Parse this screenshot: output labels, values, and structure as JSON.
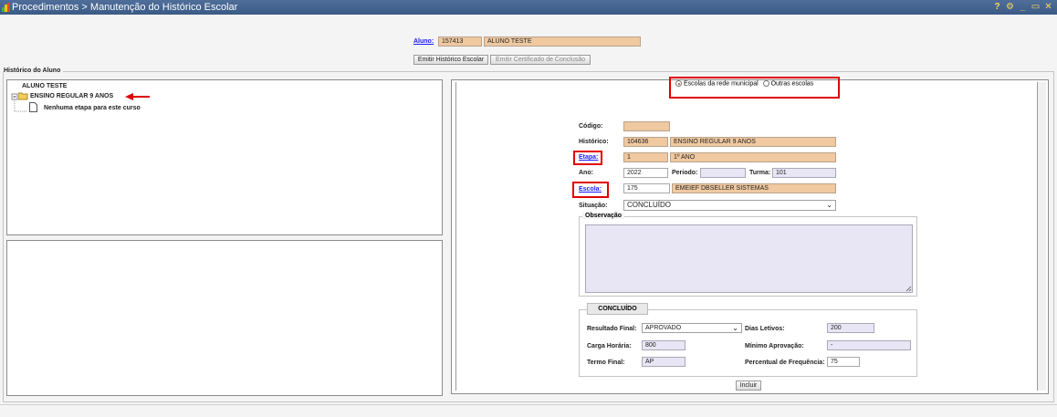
{
  "window": {
    "title": "Procedimentos > Manutenção do Histórico Escolar",
    "controls": [
      "?",
      "⚙",
      "_",
      "▭",
      "✕"
    ]
  },
  "aluno": {
    "label": "Aluno:",
    "code": "157413",
    "name": "ALUNO TESTE"
  },
  "buttons": {
    "emitir_historico": "Emitir Histórico Escolar",
    "emitir_certificado": "Emitir Certificado de Conclusão",
    "incluir": "Incluir"
  },
  "historico_section": {
    "title": "Histórico do Aluno",
    "tree_root": "ALUNO TESTE",
    "tree_course": "ENSINO REGULAR 9 ANOS",
    "tree_empty": "Nenhuma etapa para este curso"
  },
  "school_filter": {
    "option_municipal": "Escolas da rede municipal",
    "option_outras": "Outras escolas",
    "selected": "municipal"
  },
  "form": {
    "codigo_label": "Código:",
    "codigo_value": "",
    "historico_label": "Histórico:",
    "historico_code": "104636",
    "historico_name": "ENSINO REGULAR 9 ANOS",
    "etapa_label": "Etapa:",
    "etapa_code": "1",
    "etapa_name": "1º ANO",
    "ano_label": "Ano:",
    "ano_value": "2022",
    "periodo_label": "Periodo:",
    "periodo_value": "",
    "turma_label": "Turma:",
    "turma_value": "101",
    "escola_label": "Escola:",
    "escola_code": "175",
    "escola_name": "EMEIEF DBSELLER SISTEMAS",
    "situacao_label": "Situação:",
    "situacao_value": "CONCLUÍDO",
    "observacao_label": "Observação",
    "observacao_value": ""
  },
  "concluido": {
    "title": "CONCLUÍDO",
    "resultado_label": "Resultado Final:",
    "resultado_value": "APROVADO",
    "dias_label": "Dias Letivos:",
    "dias_value": "200",
    "carga_label": "Carga Horária:",
    "carga_value": "800",
    "minimo_label": "Mínimo Aprovação:",
    "minimo_value": "-",
    "termo_label": "Termo Final:",
    "termo_value": "AP",
    "percentual_label": "Percentual de Frequência:",
    "percentual_value": "75"
  },
  "colors": {
    "titlebar": "#3b5a86",
    "readonly_field": "#f0c9a1",
    "highlight": "#e00000",
    "link": "#1a1aff"
  }
}
